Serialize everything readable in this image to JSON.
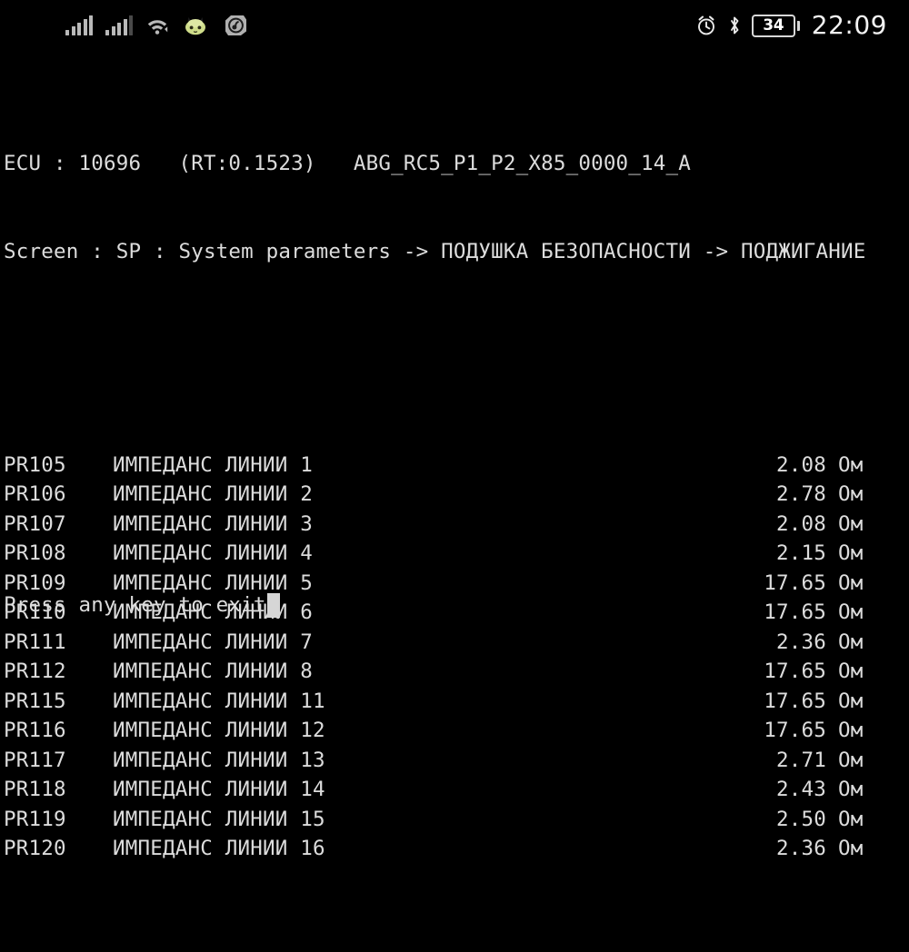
{
  "status_bar": {
    "icons": [
      {
        "name": "signal-bars-sim1",
        "label": "signal-icon"
      },
      {
        "name": "signal-bars-sim2",
        "label": "signal-icon"
      },
      {
        "name": "wifi-icon",
        "label": "wifi-icon"
      },
      {
        "name": "game-app-icon",
        "label": "app-icon"
      },
      {
        "name": "music-app-icon",
        "label": "app-icon"
      }
    ],
    "alarm_icon": "alarm-icon",
    "bluetooth_icon": "bluetooth-icon",
    "battery_level": "34",
    "time": "22:09",
    "colors": {
      "background": "#000000",
      "icon": "#b9b9b9",
      "text": "#f2f2f2",
      "game_icon": "#cfdd8a",
      "music_icon": "#b0b0b0"
    }
  },
  "terminal": {
    "colors": {
      "background": "#000000",
      "text": "#dcdcdc",
      "cursor": "#d6d6d6"
    },
    "header": {
      "ecu_line": "ECU : 10696   (RT:0.1523)   ABG_RC5_P1_P2_X85_0000_14_A",
      "ecu_label": "ECU :",
      "ecu_id": "10696",
      "rt_value": "(RT:0.1523)",
      "part_number": "ABG_RC5_P1_P2_X85_0000_14_A",
      "screen_line": "Screen : SP : System parameters -> ПОДУШКА БЕЗОПАСНОСТИ -> ПОДЖИГАНИЕ",
      "screen_label": "Screen :",
      "screen_code": "SP",
      "breadcrumb": "System parameters -> ПОДУШКА БЕЗОПАСНОСТИ -> ПОДЖИГАНИЕ"
    },
    "parameters": [
      {
        "pid": "PR105",
        "name": "ИМПЕДАНС ЛИНИИ 1",
        "value": "2.08",
        "unit": "Ом"
      },
      {
        "pid": "PR106",
        "name": "ИМПЕДАНС ЛИНИИ 2",
        "value": "2.78",
        "unit": "Ом"
      },
      {
        "pid": "PR107",
        "name": "ИМПЕДАНС ЛИНИИ 3",
        "value": "2.08",
        "unit": "Ом"
      },
      {
        "pid": "PR108",
        "name": "ИМПЕДАНС ЛИНИИ 4",
        "value": "2.15",
        "unit": "Ом"
      },
      {
        "pid": "PR109",
        "name": "ИМПЕДАНС ЛИНИИ 5",
        "value": "17.65",
        "unit": "Ом"
      },
      {
        "pid": "PR110",
        "name": "ИМПЕДАНС ЛИНИИ 6",
        "value": "17.65",
        "unit": "Ом"
      },
      {
        "pid": "PR111",
        "name": "ИМПЕДАНС ЛИНИИ 7",
        "value": "2.36",
        "unit": "Ом"
      },
      {
        "pid": "PR112",
        "name": "ИМПЕДАНС ЛИНИИ 8",
        "value": "17.65",
        "unit": "Ом"
      },
      {
        "pid": "PR115",
        "name": "ИМПЕДАНС ЛИНИИ 11",
        "value": "17.65",
        "unit": "Ом"
      },
      {
        "pid": "PR116",
        "name": "ИМПЕДАНС ЛИНИИ 12",
        "value": "17.65",
        "unit": "Ом"
      },
      {
        "pid": "PR117",
        "name": "ИМПЕДАНС ЛИНИИ 13",
        "value": "2.71",
        "unit": "Ом"
      },
      {
        "pid": "PR118",
        "name": "ИМПЕДАНС ЛИНИИ 14",
        "value": "2.43",
        "unit": "Ом"
      },
      {
        "pid": "PR119",
        "name": "ИМПЕДАНС ЛИНИИ 15",
        "value": "2.50",
        "unit": "Ом"
      },
      {
        "pid": "PR120",
        "name": "ИМПЕДАНС ЛИНИИ 16",
        "value": "2.36",
        "unit": "Ом"
      }
    ],
    "footer": {
      "prompt": "Press any key to exit"
    }
  }
}
